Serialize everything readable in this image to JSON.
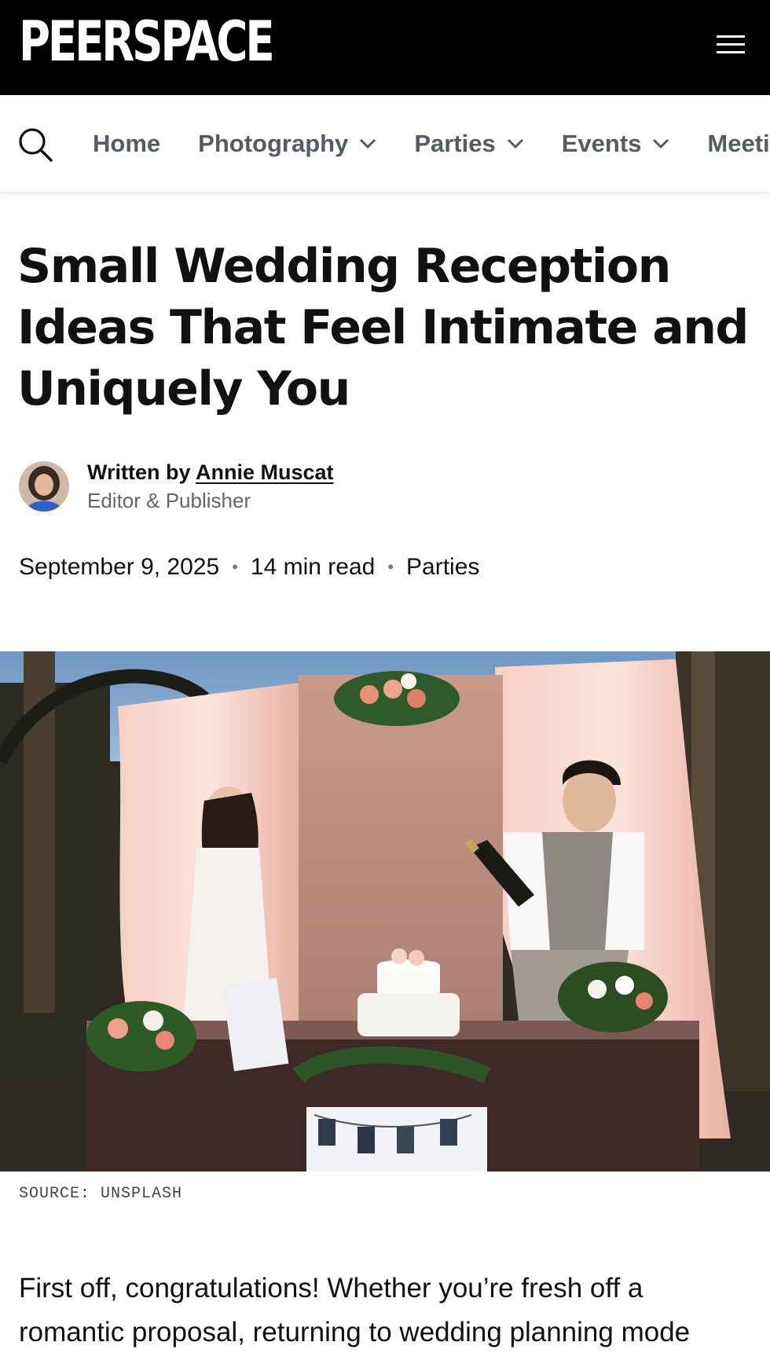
{
  "header": {
    "logo_text": "PEERSPACE",
    "menu_icon": "hamburger-menu-icon",
    "background": "#000000"
  },
  "nav": {
    "search_icon": "search-icon",
    "items": [
      {
        "label": "Home",
        "has_dropdown": false
      },
      {
        "label": "Photography",
        "has_dropdown": true
      },
      {
        "label": "Parties",
        "has_dropdown": true
      },
      {
        "label": "Events",
        "has_dropdown": true
      },
      {
        "label": "Meetings",
        "has_dropdown": false
      }
    ]
  },
  "article": {
    "title": "Small Wedding Reception Ideas That Feel Intimate and Uniquely You",
    "author_prefix": "Written by",
    "author_name": "Annie Muscat",
    "author_role": "Editor & Publisher",
    "date": "September 9, 2025",
    "read_time": "14 min read",
    "category": "Parties",
    "image_source": "SOURCE: UNSPLASH",
    "intro": "First off, congratulations! Whether you’re fresh off a romantic proposal, returning to wedding planning mode"
  }
}
